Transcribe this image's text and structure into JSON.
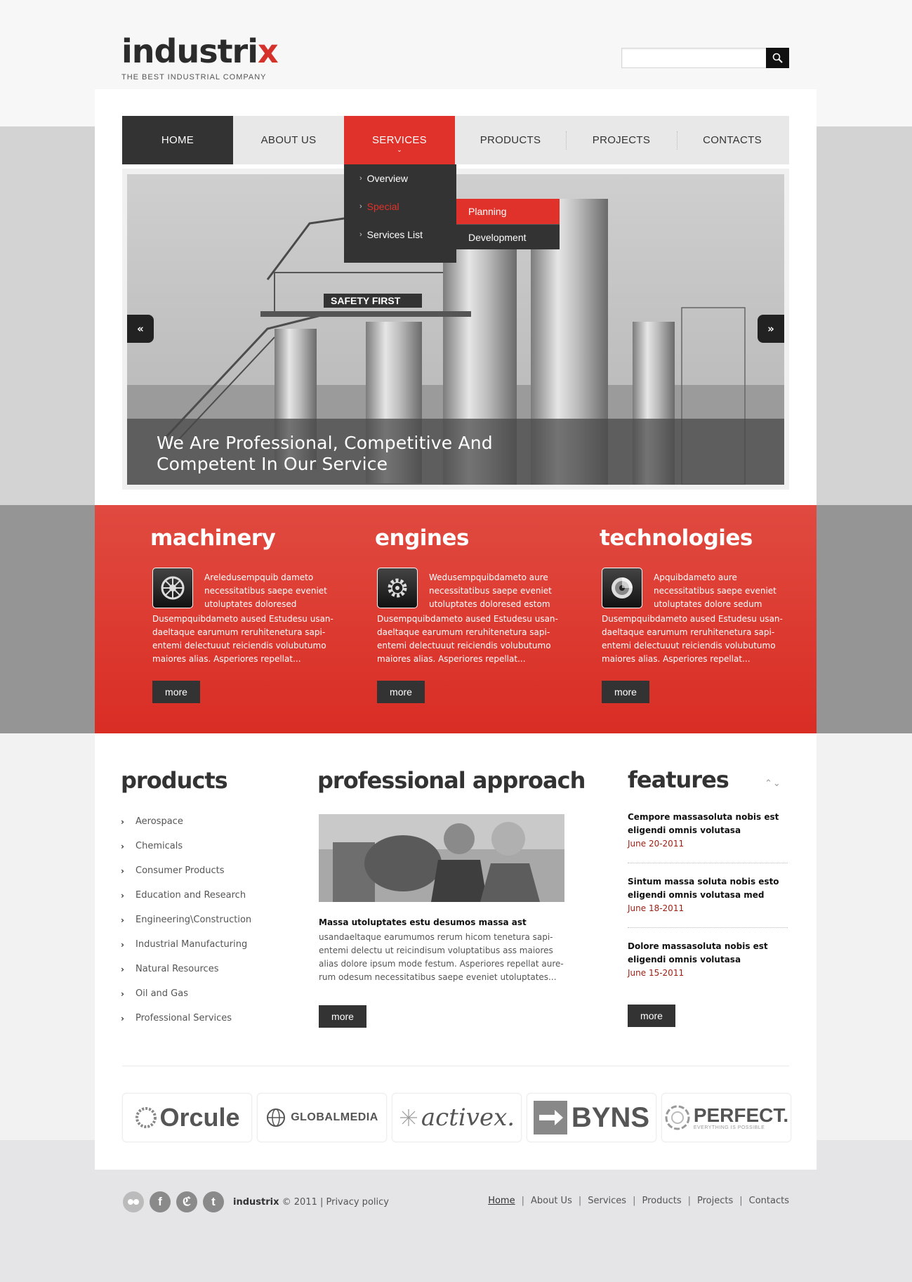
{
  "header": {
    "logo_text_a": "industri",
    "logo_text_b": "x",
    "tagline": "THE BEST INDUSTRIAL COMPANY",
    "search": {
      "placeholder": "",
      "value": ""
    }
  },
  "nav": {
    "items": [
      "HOME",
      "ABOUT US",
      "SERVICES",
      "PRODUCTS",
      "PROJECTS",
      "CONTACTS"
    ],
    "active": "SERVICES",
    "dropdown": [
      "Overview",
      "Special",
      "Services List"
    ],
    "submenu": [
      "Planning",
      "Development"
    ]
  },
  "slider": {
    "caption_line1": "We Are Professional, Competitive And",
    "caption_line2": "Competent In Our Service",
    "sign": "SAFETY FIRST",
    "prev": "«",
    "next": "»"
  },
  "features_band": [
    {
      "title": "machinery",
      "icon": "gear-wheel-icon",
      "intro": "Areledusempquib dameto necessitatibus saepe eveniet utoluptates doloresed",
      "body": "Dusempquibdameto aused Estudesu usan-daeltaque earumum reruhitenetura sapi-entemi delectuuut reiciendis volubutumo maiores alias. Asperiores repellat...",
      "more": "more"
    },
    {
      "title": "engines",
      "icon": "cog-icon",
      "intro": "Wedusempquibdameto aure necessitatibus saepe eveniet utoluptates doloresed estom",
      "body": "Dusempquibdameto aused Estudesu usan-daeltaque earumum reruhitenetura sapi-entemi delectuuut reiciendis volubutumo maiores alias. Asperiores repellat...",
      "more": "more"
    },
    {
      "title": "technologies",
      "icon": "disc-icon",
      "intro": "Apquibdameto aure necessitatibus saepe eveniet utoluptates dolore sedum",
      "body": "Dusempquibdameto aused Estudesu usan-daeltaque earumum reruhitenetura sapi-entemi delectuuut reiciendis volubutumo maiores alias. Asperiores repellat...",
      "more": "more"
    }
  ],
  "products": {
    "title": "products",
    "items": [
      "Aerospace",
      "Chemicals",
      "Consumer Products",
      "Education and Research",
      "Engineering\\Construction",
      "Industrial Manufacturing",
      "Natural Resources",
      "Oil and Gas",
      "Professional Services"
    ]
  },
  "approach": {
    "title": "professional approach",
    "heading": "Massa utoluptates estu desumos massa ast",
    "text": "usandaeltaque earumumos rerum hicom tenetura sapi-entemi delectu ut reicindisum voluptatibus ass maiores alias dolore ipsum mode festum. Asperiores repellat aure-rum odesum necessitatibus saepe eveniet utoluptates...",
    "more": "more"
  },
  "features": {
    "title": "features",
    "items": [
      {
        "title": "Cempore massasoluta nobis est eligendi  omnis volutasa",
        "date": "June 20-2011"
      },
      {
        "title": "Sintum massa soluta nobis esto eligendi  omnis volutasa med",
        "date": "June 18-2011"
      },
      {
        "title": "Dolore massasoluta nobis est eligendi  omnis volutasa",
        "date": "June 15-2011"
      }
    ],
    "more": "more"
  },
  "brands": [
    "Orcule",
    "GLOBALMEDIA",
    "activex.",
    "BYNS",
    "PERFECT."
  ],
  "brand_perfect_sub": "EVERYTHING IS POSSIBLE",
  "footer": {
    "brand": "industrix",
    "copy": "© 2011 | Privacy policy",
    "social": [
      "flickr-icon",
      "facebook-icon",
      "stumbleupon-icon",
      "twitter-icon"
    ],
    "nav": [
      "Home",
      "About Us",
      "Services",
      "Products",
      "Projects",
      "Contacts"
    ]
  },
  "colors": {
    "accent": "#e0322a",
    "dark": "#333333"
  }
}
